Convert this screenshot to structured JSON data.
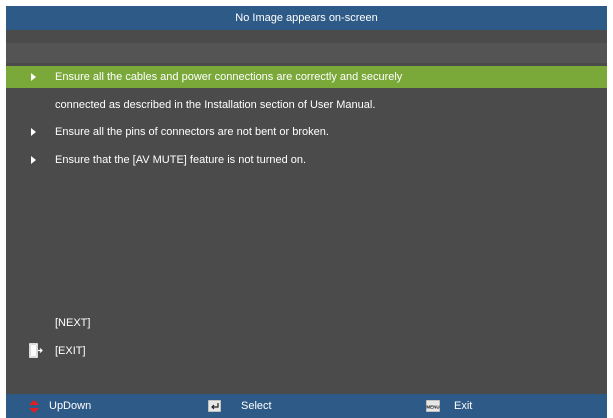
{
  "window": {
    "title": "No Image appears on-screen"
  },
  "items": [
    {
      "text": "Ensure all the cables and power connections are correctly and securely",
      "selected": true,
      "bullet": true
    },
    {
      "text": "connected as described in the Installation section of User Manual.",
      "selected": false,
      "bullet": false
    },
    {
      "text": "Ensure all the pins of connectors are not bent or broken.",
      "selected": false,
      "bullet": true
    },
    {
      "text": "Ensure that the [AV MUTE] feature is not turned on.",
      "selected": false,
      "bullet": true
    }
  ],
  "nav": {
    "next_label": "[NEXT]",
    "exit_label": "[EXIT]"
  },
  "footer": {
    "updown": {
      "icon": "updown-arrow-icon",
      "label": "UpDown"
    },
    "select": {
      "icon": "enter-key-icon",
      "label": "Select"
    },
    "exit": {
      "icon": "menu-key-icon",
      "key_text": "MENU",
      "label": "Exit"
    }
  },
  "colors": {
    "title_bar": "#2e5a87",
    "panel": "#4b4b4b",
    "selected": "#7aa93a",
    "text": "#ffffff",
    "updown_icon": "#e02020"
  }
}
